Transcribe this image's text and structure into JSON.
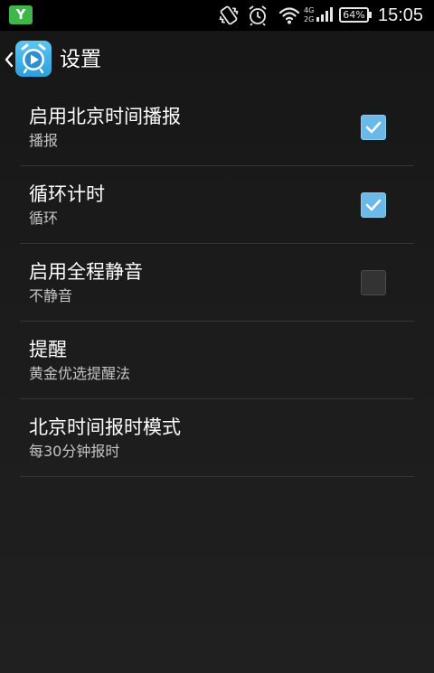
{
  "status_bar": {
    "notification_icon": "Y",
    "vibrate_icon": "vibrate-icon",
    "alarm_icon": "alarm-clock-icon",
    "wifi_icon": "wifi-icon",
    "network_top": "4G",
    "network_bottom": "2G",
    "battery_percent": "64%",
    "time": "15:05"
  },
  "action_bar": {
    "back_icon": "chevron-left-icon",
    "app_icon": "alarm-clock-play-icon",
    "title": "设置"
  },
  "settings": [
    {
      "title": "启用北京时间播报",
      "summary": "播报",
      "checkbox": true,
      "checked": true
    },
    {
      "title": "循环计时",
      "summary": "循环",
      "checkbox": true,
      "checked": true
    },
    {
      "title": "启用全程静音",
      "summary": "不静音",
      "checkbox": true,
      "checked": false
    },
    {
      "title": "提醒",
      "summary": "黄金优选提醒法",
      "checkbox": false
    },
    {
      "title": "北京时间报时模式",
      "summary": "每30分钟报时",
      "checkbox": false
    }
  ],
  "colors": {
    "accent": "#6ab9e8",
    "notification_green": "#3fb54a",
    "background": "#1b1b1b"
  }
}
